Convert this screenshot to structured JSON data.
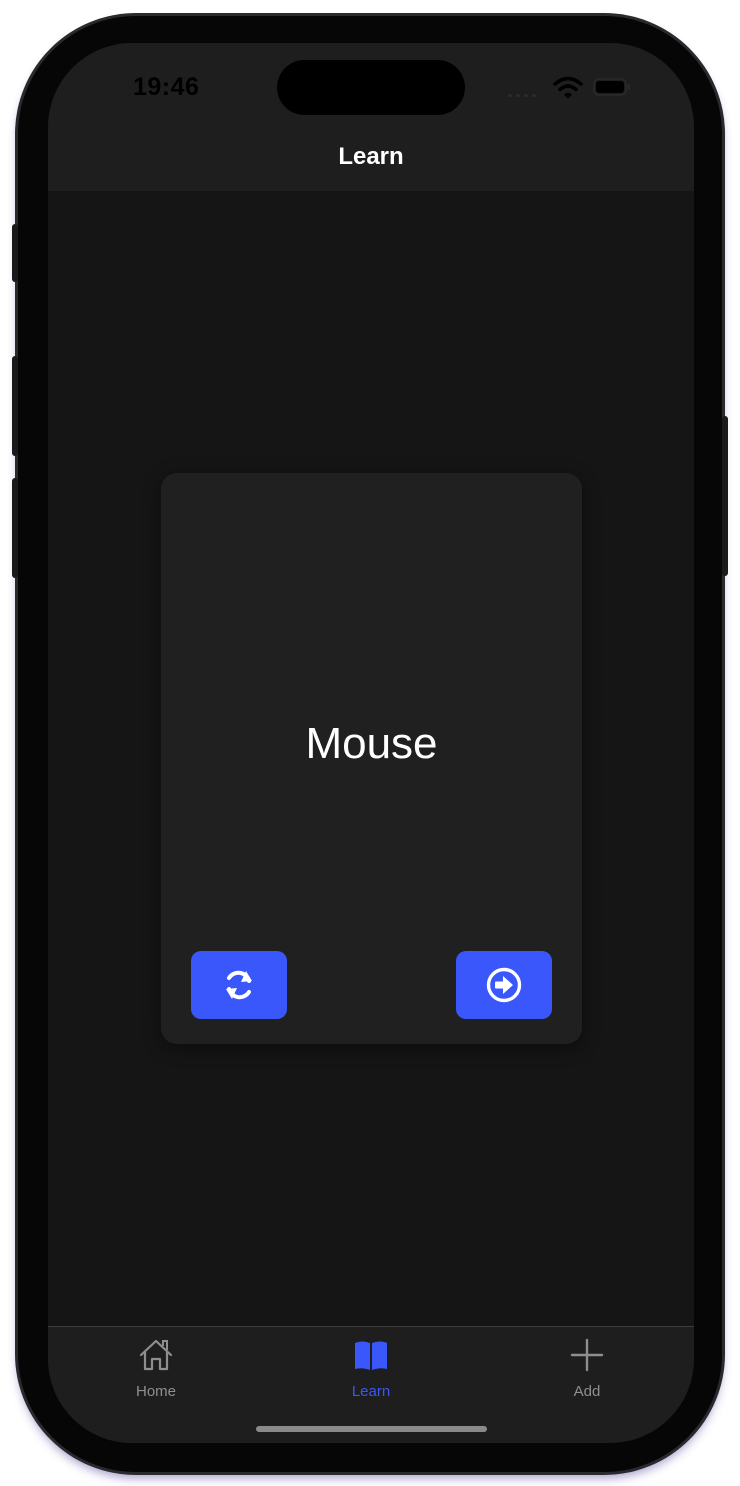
{
  "status_bar": {
    "time": "19:46"
  },
  "nav": {
    "title": "Learn"
  },
  "card": {
    "word": "Mouse",
    "flip_icon": "refresh-icon",
    "next_icon": "arrow-right-circle-icon"
  },
  "tabs": [
    {
      "label": "Home",
      "icon": "house-icon",
      "active": false
    },
    {
      "label": "Learn",
      "icon": "book-icon",
      "active": true
    },
    {
      "label": "Add",
      "icon": "plus-icon",
      "active": false
    }
  ],
  "colors": {
    "accent": "#3a57fc",
    "background": "#151515",
    "card": "#202020",
    "bar": "#1e1e1e",
    "inactive_tab": "#8f8f8f"
  }
}
